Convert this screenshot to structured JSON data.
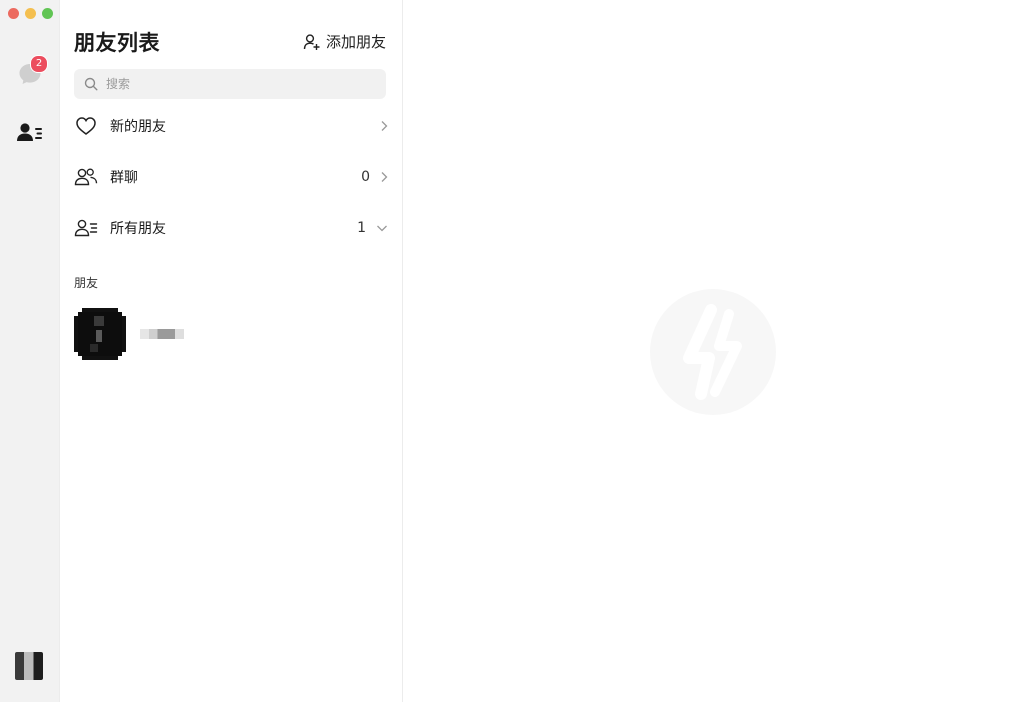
{
  "rail": {
    "chat_badge": "2"
  },
  "panel": {
    "title": "朋友列表",
    "add_friend_label": "添加朋友"
  },
  "search": {
    "placeholder": "搜索"
  },
  "rows": [
    {
      "label": "新的朋友",
      "count": ""
    },
    {
      "label": "群聊",
      "count": "0"
    },
    {
      "label": "所有朋友",
      "count": "1"
    }
  ],
  "friends_section": {
    "label": "朋友"
  },
  "colors": {
    "badge": "#ec4d5e",
    "rail_bg": "#f2f2f2",
    "search_bg": "#f1f1f1"
  }
}
